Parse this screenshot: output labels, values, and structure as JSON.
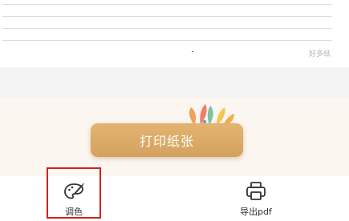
{
  "paper": {
    "watermark": "好多纸"
  },
  "banner": {
    "print_button_label": "打印纸张"
  },
  "toolbar": {
    "items": [
      {
        "label": "调色",
        "icon": "palette-icon"
      },
      {
        "label": "导出pdf",
        "icon": "printer-icon"
      }
    ]
  },
  "colors": {
    "accent": "#d9a862",
    "highlight": "#d51f1f"
  }
}
